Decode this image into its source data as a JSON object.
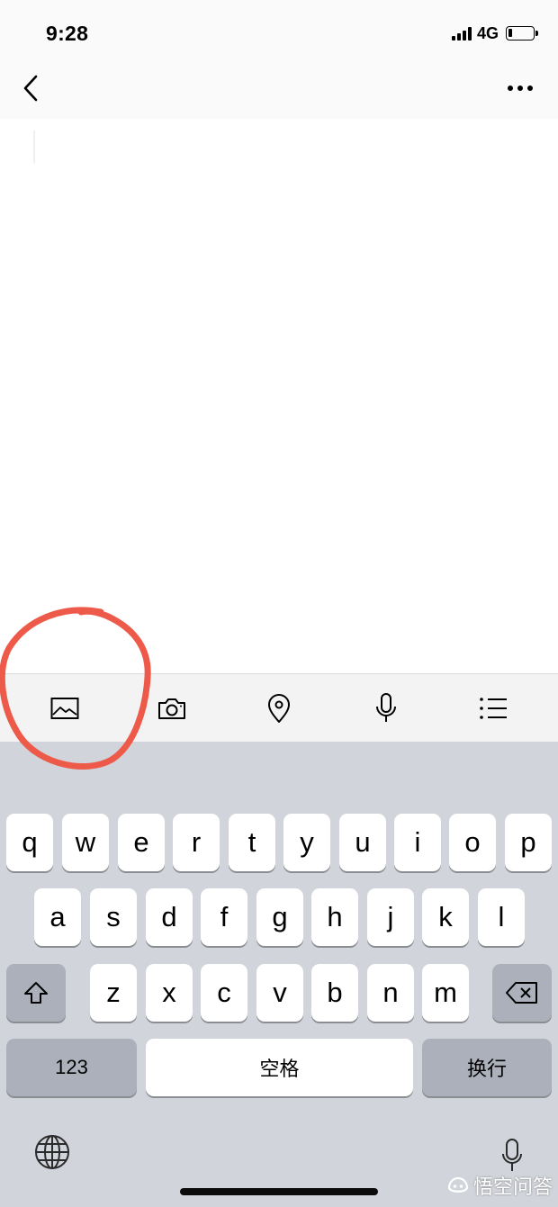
{
  "status_bar": {
    "time": "9:28",
    "network": "4G",
    "battery_level": 0.15
  },
  "nav_bar": {
    "back_icon": "chevron-left-icon",
    "more_icon": "ellipsis-icon"
  },
  "toolbar": {
    "items": [
      {
        "name": "image",
        "icon": "image-icon"
      },
      {
        "name": "camera",
        "icon": "camera-icon"
      },
      {
        "name": "location",
        "icon": "location-pin-icon"
      },
      {
        "name": "voice",
        "icon": "microphone-icon"
      },
      {
        "name": "list",
        "icon": "list-icon"
      }
    ]
  },
  "keyboard": {
    "row1": [
      "q",
      "w",
      "e",
      "r",
      "t",
      "y",
      "u",
      "i",
      "o",
      "p"
    ],
    "row2": [
      "a",
      "s",
      "d",
      "f",
      "g",
      "h",
      "j",
      "k",
      "l"
    ],
    "row3": [
      "z",
      "x",
      "c",
      "v",
      "b",
      "n",
      "m"
    ],
    "numbers_label": "123",
    "space_label": "空格",
    "return_label": "换行",
    "shift_icon": "shift-icon",
    "delete_icon": "backspace-icon",
    "globe_icon": "globe-icon",
    "dictation_icon": "microphone-icon"
  },
  "watermark": {
    "text": "悟空问答"
  },
  "colors": {
    "keyboard_bg": "#d1d4da",
    "key_bg": "#ffffff",
    "func_key_bg": "#abb0ba",
    "annotation": "#ee5a4a",
    "toolbar_bg": "#f3f3f3"
  }
}
